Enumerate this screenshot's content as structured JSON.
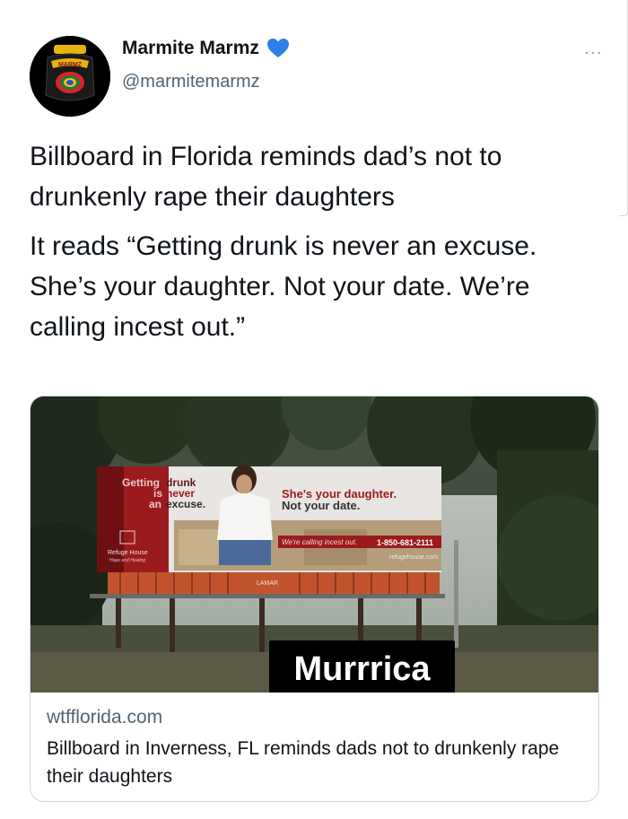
{
  "tweet": {
    "author_name": "Marmite Marmz",
    "handle": "@marmitemarmz",
    "more_label": "···",
    "paragraphs": [
      "Billboard in Florida reminds dad’s not to drunkenly rape their daughters",
      "It reads “Getting drunk is never an excuse. She’s your daughter. Not your date. We’re calling incest out.”"
    ]
  },
  "avatar": {
    "jar_label": "MARMZ"
  },
  "billboard": {
    "line1_a": "Getting",
    "line1_b": "drunk",
    "line2_a": "is",
    "line2_b": "never",
    "line3_a": "an",
    "line3_b": "excuse.",
    "right_line1": "She's your daughter.",
    "right_line2": "Not your date.",
    "strip_text": "We're calling incest out.",
    "phone": "1-850-681-2111",
    "website": "refugehouse.com",
    "org_name": "Refuge House",
    "org_tagline": "Hope and Healing",
    "footer_brand": "LAMAR"
  },
  "image_caption": "Murrrica",
  "link_card": {
    "domain": "wtfflorida.com",
    "title": "Billboard in Inverness, FL reminds dads not to drunkenly rape their daughters"
  },
  "colors": {
    "verified_badge": "#2f7fe8",
    "billboard_red": "#9b1b1d",
    "handle_gray": "#536471"
  }
}
